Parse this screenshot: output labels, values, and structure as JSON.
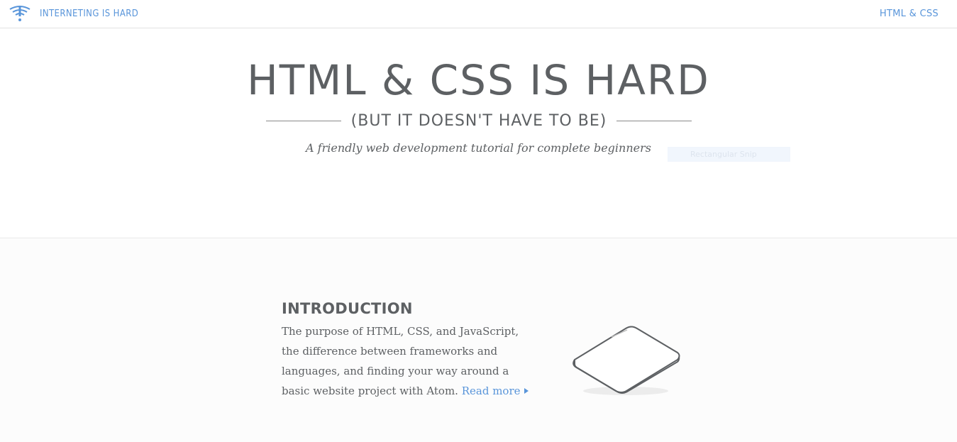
{
  "header": {
    "brand": "INTERNETING IS HARD",
    "nav_link": "HTML & CSS"
  },
  "hero": {
    "title": "HTML & CSS IS HARD",
    "subtitle": "(BUT IT DOESN'T HAVE TO BE)",
    "tagline": "A friendly web development tutorial for complete beginners"
  },
  "overlay": {
    "snip_label": "Rectangular Snip"
  },
  "intro": {
    "heading": "INTRODUCTION",
    "body": "The purpose of HTML, CSS, and JavaScript, the difference between frameworks and languages, and finding your way around a basic website project with Atom.",
    "read_more": "Read more"
  },
  "icons": {
    "logo": "interneting-is-hard-logo-icon",
    "read_more_arrow": "triangle-right-icon",
    "illustration": "tablet-device-icon"
  },
  "colors": {
    "accent": "#5995da",
    "text": "#5d6063",
    "divider": "#e3e3e3"
  }
}
